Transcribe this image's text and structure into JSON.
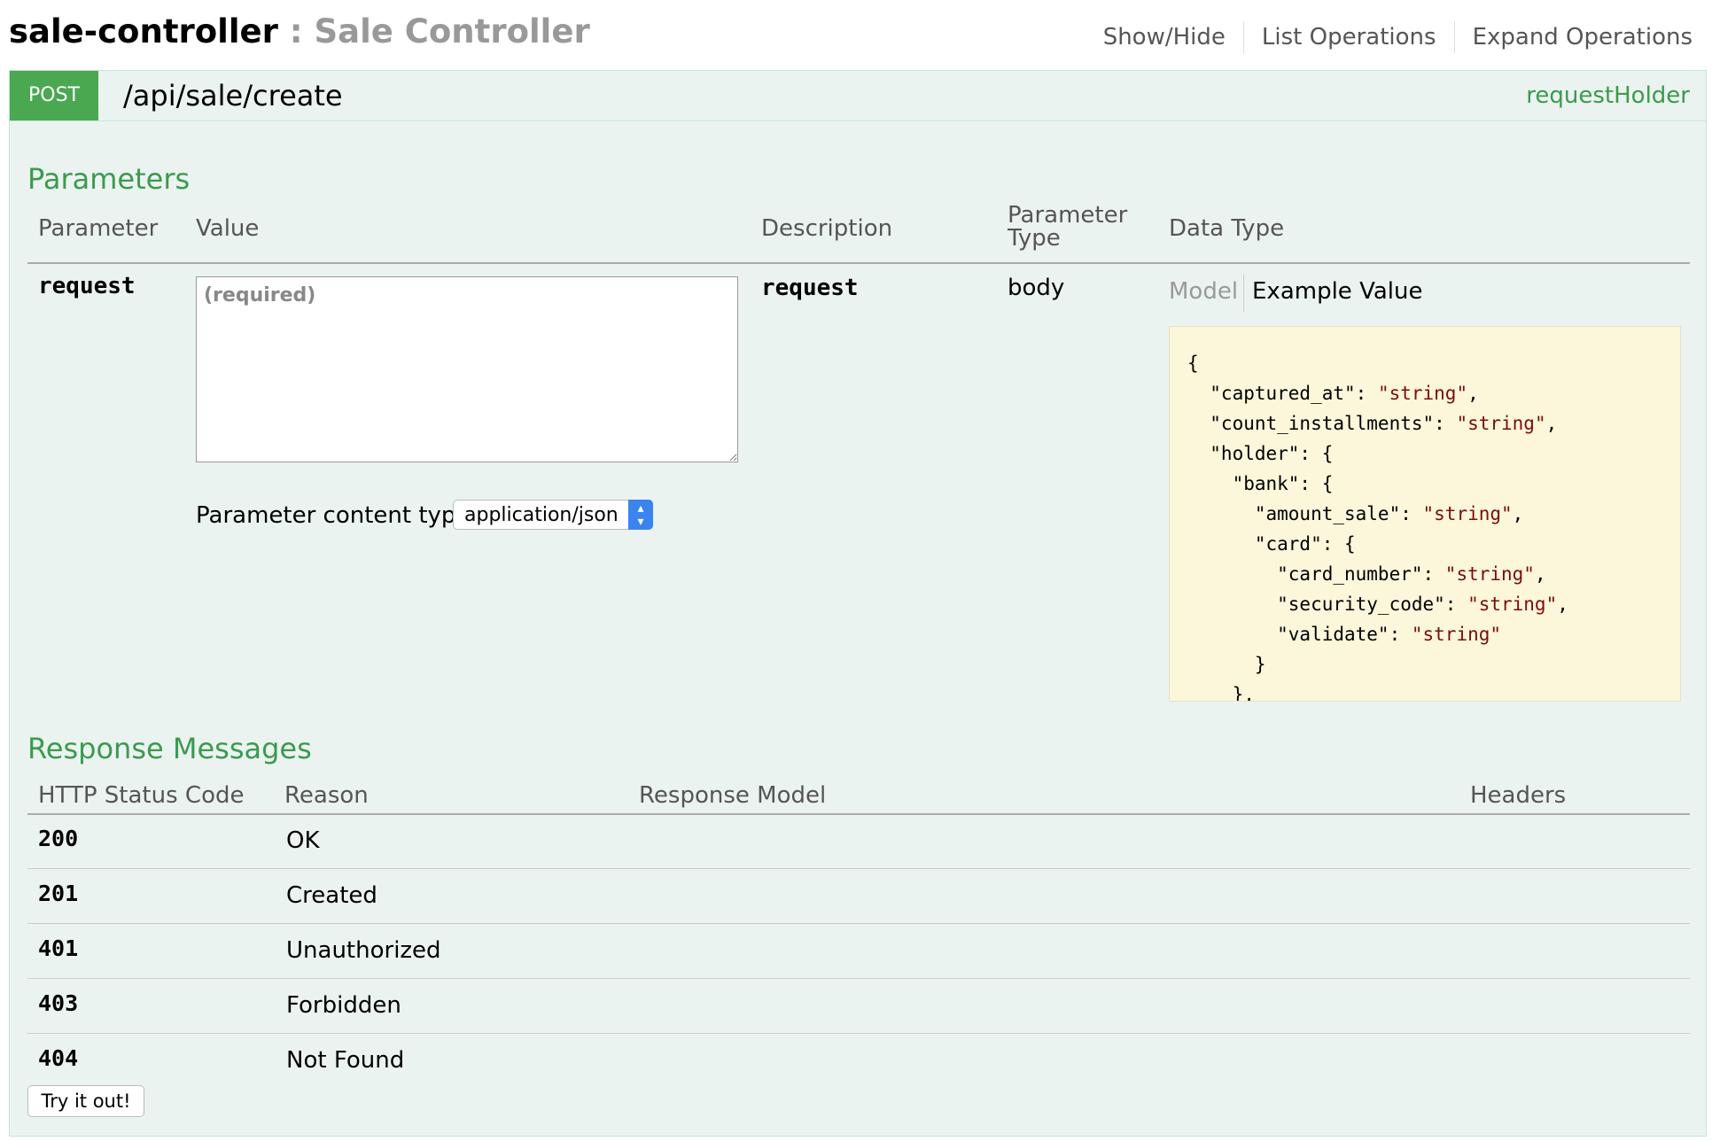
{
  "resource": {
    "name": "sale-controller",
    "separator": " : ",
    "description": "Sale Controller",
    "links": [
      "Show/Hide",
      "List Operations",
      "Expand Operations"
    ]
  },
  "operation": {
    "method": "POST",
    "path": "/api/sale/create",
    "summary": "requestHolder"
  },
  "parameters": {
    "title": "Parameters",
    "headers": {
      "parameter": "Parameter",
      "value": "Value",
      "description": "Description",
      "type_line1": "Parameter",
      "type_line2": "Type",
      "data_type": "Data Type"
    },
    "row": {
      "name": "request",
      "value": "",
      "placeholder": "(required)",
      "description": "request",
      "type": "body",
      "content_type_label": "Parameter content type:",
      "content_type_value": "application/json",
      "tab_model": "Model",
      "tab_example": "Example Value"
    },
    "example_lines": [
      {
        "indent": 0,
        "key": "",
        "value": "",
        "text": "{"
      },
      {
        "indent": 1,
        "key": "\"captured_at\": ",
        "value": "\"string\"",
        "text": ","
      },
      {
        "indent": 1,
        "key": "\"count_installments\": ",
        "value": "\"string\"",
        "text": ","
      },
      {
        "indent": 1,
        "key": "\"holder\": ",
        "value": "",
        "text": "{"
      },
      {
        "indent": 2,
        "key": "\"bank\": ",
        "value": "",
        "text": "{"
      },
      {
        "indent": 3,
        "key": "\"amount_sale\": ",
        "value": "\"string\"",
        "text": ","
      },
      {
        "indent": 3,
        "key": "\"card\": ",
        "value": "",
        "text": "{"
      },
      {
        "indent": 4,
        "key": "\"card_number\": ",
        "value": "\"string\"",
        "text": ","
      },
      {
        "indent": 4,
        "key": "\"security_code\": ",
        "value": "\"string\"",
        "text": ","
      },
      {
        "indent": 4,
        "key": "\"validate\": ",
        "value": "\"string\"",
        "text": ""
      },
      {
        "indent": 3,
        "key": "",
        "value": "",
        "text": "}"
      },
      {
        "indent": 2,
        "key": "",
        "value": "",
        "text": "},"
      }
    ]
  },
  "responses": {
    "title": "Response Messages",
    "headers": {
      "status": "HTTP Status Code",
      "reason": "Reason",
      "model": "Response Model",
      "headers": "Headers"
    },
    "rows": [
      {
        "code": "200",
        "reason": "OK"
      },
      {
        "code": "201",
        "reason": "Created"
      },
      {
        "code": "401",
        "reason": "Unauthorized"
      },
      {
        "code": "403",
        "reason": "Forbidden"
      },
      {
        "code": "404",
        "reason": "Not Found"
      }
    ]
  },
  "try_button": "Try it out!"
}
